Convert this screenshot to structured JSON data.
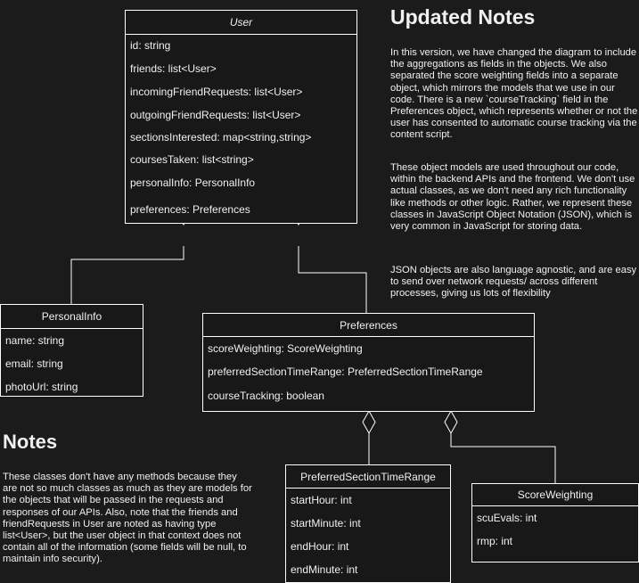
{
  "user": {
    "title": "User",
    "fields": [
      "id: string",
      "friends: list<User>",
      "incomingFriendRequests: list<User>",
      "outgoingFriendRequests: list<User>",
      "sectionsInterested: map<string,string>",
      "coursesTaken: list<string>",
      "personalInfo: PersonalInfo",
      "preferences: Preferences"
    ]
  },
  "personal_info": {
    "title": "PersonalInfo",
    "fields": [
      "name: string",
      "email: string",
      "photoUrl: string"
    ]
  },
  "preferences": {
    "title": "Preferences",
    "fields": [
      "scoreWeighting: ScoreWeighting",
      "preferredSectionTimeRange: PreferredSectionTimeRange",
      "courseTracking: boolean"
    ]
  },
  "preferred_section_time_range": {
    "title": "PreferredSectionTimeRange",
    "fields": [
      "startHour: int",
      "startMinute: int",
      "endHour: int",
      "endMinute: int"
    ]
  },
  "score_weighting": {
    "title": "ScoreWeighting",
    "fields": [
      "scuEvals: int",
      "rmp: int"
    ]
  },
  "updated_notes": {
    "title": "Updated Notes",
    "paragraphs": [
      "In this version, we have changed the diagram to include the aggregations as fields in the objects. We also separated the score weighting fields into a separate object, which mirrors the models that we use in our code. There is a new `courseTracking` field in the Preferences object, which represents whether or not the user has consented to automatic course tracking via the content script.",
      "These object models are used throughout our code, within the backend APIs and the frontend. We don't use actual classes, as we don't need any rich functionality like methods or other logic. Rather, we represent these classes in JavaScript Object Notation (JSON), which is very common in JavaScript for storing data.",
      "JSON objects are also language agnostic, and are easy to send over network requests/ across different processes, giving us lots of flexibility"
    ]
  },
  "notes": {
    "title": "Notes",
    "paragraph": "These classes don't have any methods because they are not so much classes as much as they are models for the objects that will be passed in the requests and responses of our APIs. Also, note that the friends and friendRequests in User are noted as having type list<User>, but the user object in that context does not contain all of the information (some fields will be null, to maintain info security)."
  }
}
